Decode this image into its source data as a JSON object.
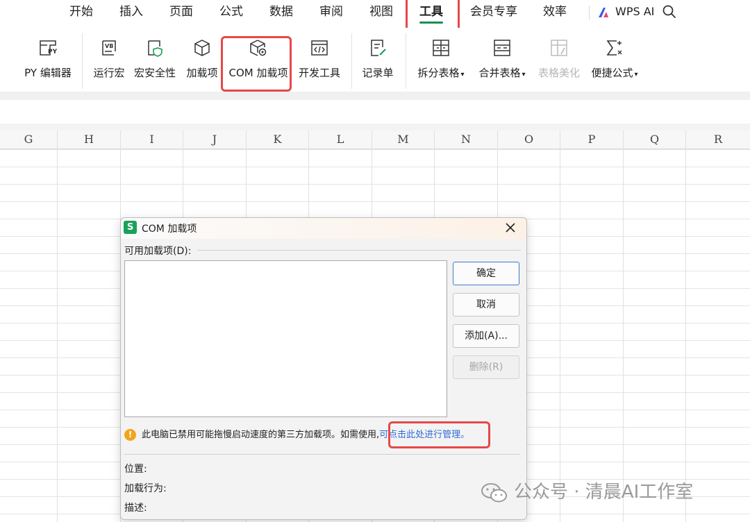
{
  "menu": {
    "tabs": [
      "开始",
      "插入",
      "页面",
      "公式",
      "数据",
      "审阅",
      "视图",
      "工具",
      "会员专享",
      "效率"
    ],
    "active_tab": "工具",
    "wps_ai": "WPS AI"
  },
  "ribbon": {
    "py_editor": "PY 编辑器",
    "run_macro": "运行宏",
    "macro_security": "宏安全性",
    "addins": "加载项",
    "com_addins": "COM 加载项",
    "dev_tools": "开发工具",
    "record_form": "记录单",
    "split_table": "拆分表格",
    "merge_table": "合并表格",
    "beautify_table": "表格美化",
    "quick_formula": "便捷公式"
  },
  "sheet": {
    "columns": [
      "G",
      "H",
      "I",
      "J",
      "K",
      "L",
      "M",
      "N",
      "O",
      "P",
      "Q",
      "R"
    ]
  },
  "dialog": {
    "title": "COM 加载项",
    "available_label": "可用加载项(D):",
    "ok": "确定",
    "cancel": "取消",
    "add": "添加(A)...",
    "delete": "删除(R)",
    "warning_text": "此电脑已禁用可能拖慢启动速度的第三方加载项。如需使用,",
    "warning_link": "可点击此处进行管理。",
    "location_label": "位置:",
    "load_behavior_label": "加载行为:",
    "description_label": "描述:"
  },
  "watermark": "公众号 · 清晨AI工作室",
  "colors": {
    "highlight": "#e54848",
    "accent_green": "#1a8f4f",
    "link": "#2f6bd6",
    "warning": "#f2a41d"
  }
}
